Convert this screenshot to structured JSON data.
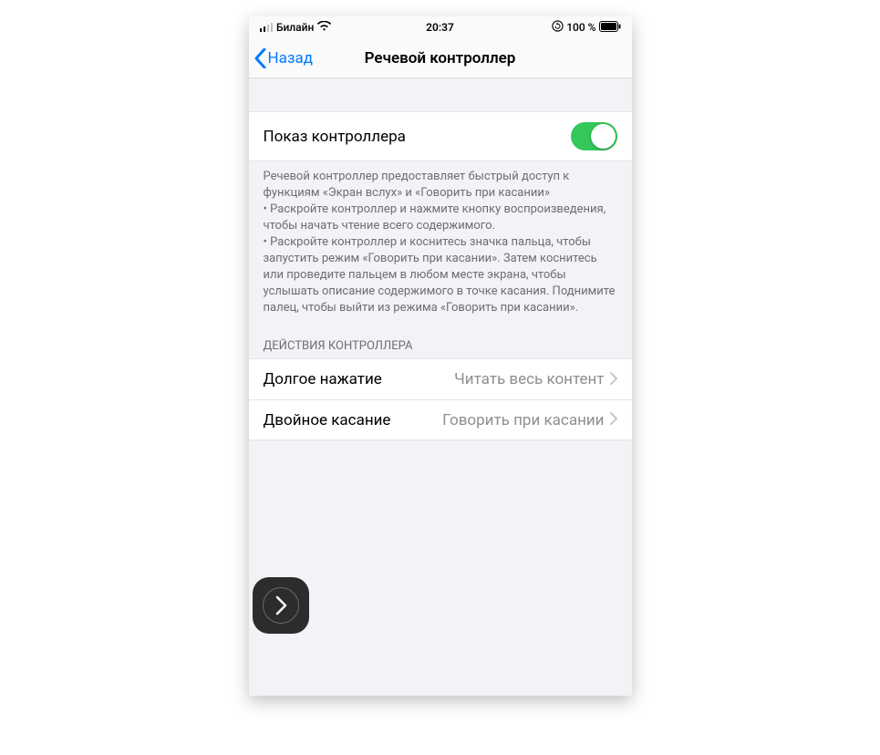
{
  "status": {
    "carrier": "Билайн",
    "time": "20:37",
    "battery_text": "100 %"
  },
  "nav": {
    "back_label": "Назад",
    "title": "Речевой контроллер"
  },
  "toggle_row": {
    "label": "Показ контроллера",
    "on": true
  },
  "footer_text": "Речевой контроллер предоставляет быстрый доступ к функциям «Экран вслух» и «Говорить при касании»\n • Раскройте контроллер и нажмите кнопку воспроизведения, чтобы начать чтение всего содержимого.\n • Раскройте контроллер и коснитесь значка пальца, чтобы запустить режим «Говорить при касании». Затем коснитесь или проведите пальцем в любом месте экрана, чтобы услышать описание содержимого в точке касания. Поднимите палец, чтобы выйти из режима «Говорить при касании».",
  "actions": {
    "header": "ДЕЙСТВИЯ КОНТРОЛЛЕРА",
    "items": [
      {
        "label": "Долгое нажатие",
        "value": "Читать весь контент"
      },
      {
        "label": "Двойное касание",
        "value": "Говорить при касании"
      }
    ]
  }
}
